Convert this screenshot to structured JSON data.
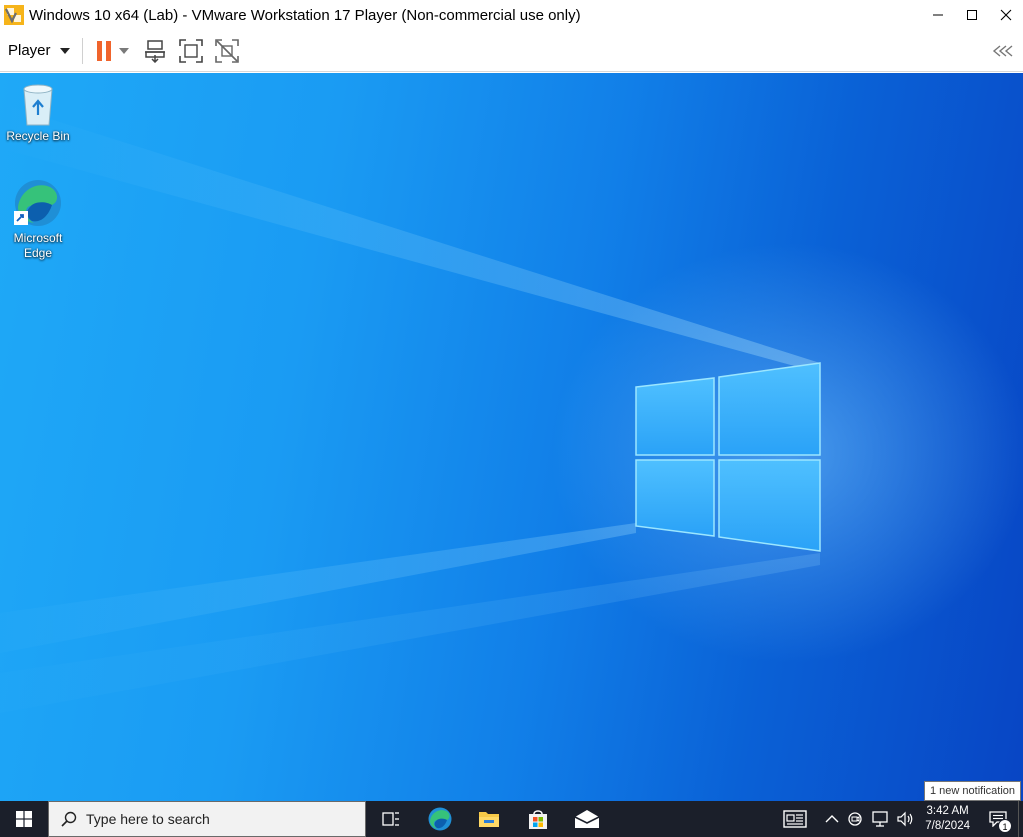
{
  "window": {
    "title": "Windows 10 x64 (Lab) - VMware Workstation 17 Player (Non-commercial use only)",
    "icon": "vmware-player-icon",
    "controls": [
      "minimize-icon",
      "maximize-icon",
      "close-icon"
    ]
  },
  "toolbar": {
    "player_menu_label": "Player",
    "buttons": [
      "pause-icon",
      "dropdown-caret-icon",
      "send-ctrl-alt-del-icon",
      "full-screen-icon",
      "unity-icon"
    ],
    "collapse_icon": "collapse-toolbar-icon"
  },
  "desktop": {
    "icons": [
      {
        "label": "Recycle Bin",
        "icon": "recycle-bin-icon"
      },
      {
        "label": "Microsoft Edge",
        "icon": "edge-icon"
      }
    ],
    "notification_tip": "1 new notification"
  },
  "taskbar": {
    "search_placeholder": "Type here to search",
    "apps": [
      "task-view-icon",
      "edge-icon",
      "file-explorer-icon",
      "store-icon",
      "mail-icon"
    ],
    "tray": [
      "news-icon",
      "chevron-up-icon",
      "meet-now-icon",
      "network-icon",
      "volume-icon"
    ],
    "time": "3:42 AM",
    "date": "7/8/2024",
    "notification_count": "1"
  },
  "colors": {
    "desktop_light": "#1fa9f7",
    "desktop_dark": "#0845c4",
    "taskbar": "#1b1f2a",
    "pause_orange": "#f0642c"
  }
}
